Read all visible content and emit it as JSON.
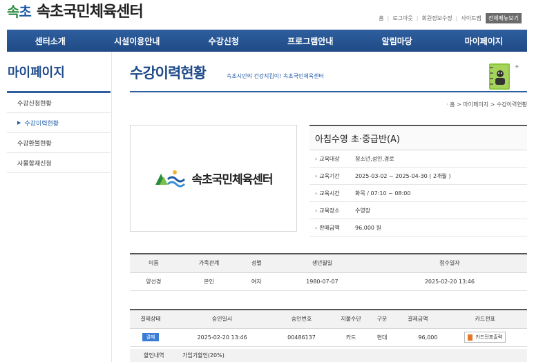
{
  "logo": {
    "mark_left": "속",
    "mark_right": "초",
    "text": "속초국민체육센터"
  },
  "top_links": [
    "홈",
    "로그아웃",
    "회원정보수정",
    "사이트맵"
  ],
  "all_menu": "전체메뉴보기",
  "nav": [
    "센터소개",
    "시설이용안내",
    "수강신청",
    "프로그램안내",
    "알림마당",
    "마이페이지"
  ],
  "sidebar": {
    "title": "마이페이지",
    "items": [
      {
        "label": "수강신청현황"
      },
      {
        "label": "수강이력현황"
      },
      {
        "label": "수강환불현황"
      },
      {
        "label": "사물함재신청"
      }
    ]
  },
  "page": {
    "title": "수강이력현황",
    "subtitle": "속초시민의 건강지킴이! 속초국민체육센터"
  },
  "breadcrumb": "· 홈 > 마이페이지 > 수강이력현황",
  "course": {
    "image_text": "속초국민체육센터",
    "name": "아침수영 초·중급반(A)",
    "rows": [
      {
        "label": "교육대상",
        "value": "청소년,성인,경로"
      },
      {
        "label": "교육기간",
        "value": "2025-03-02 ~ 2025-04-30 ( 2개월 )"
      },
      {
        "label": "교육시간",
        "value": "화목 / 07:10 ~ 08:00"
      },
      {
        "label": "교육장소",
        "value": "수영장"
      },
      {
        "label": "판매금액",
        "value": "96,000 원"
      }
    ]
  },
  "member_table": {
    "headers": [
      "이름",
      "가족관계",
      "성별",
      "생년월일",
      "접수일자"
    ],
    "row": [
      "양선경",
      "본인",
      "여자",
      "1980-07-07",
      "2025-02-20 13:46"
    ]
  },
  "payment_table": {
    "headers": [
      "결제상태",
      "승인일시",
      "승인번호",
      "지불수단",
      "구분",
      "결제금액",
      "카드전표"
    ],
    "status": "결제",
    "row": [
      "2025-02-20 13:46",
      "00486137",
      "카드",
      "현대",
      "96,000"
    ],
    "receipt_button": "카드전표출력"
  },
  "discount": {
    "label": "할인내역",
    "value": "가임기할인(20%)"
  }
}
